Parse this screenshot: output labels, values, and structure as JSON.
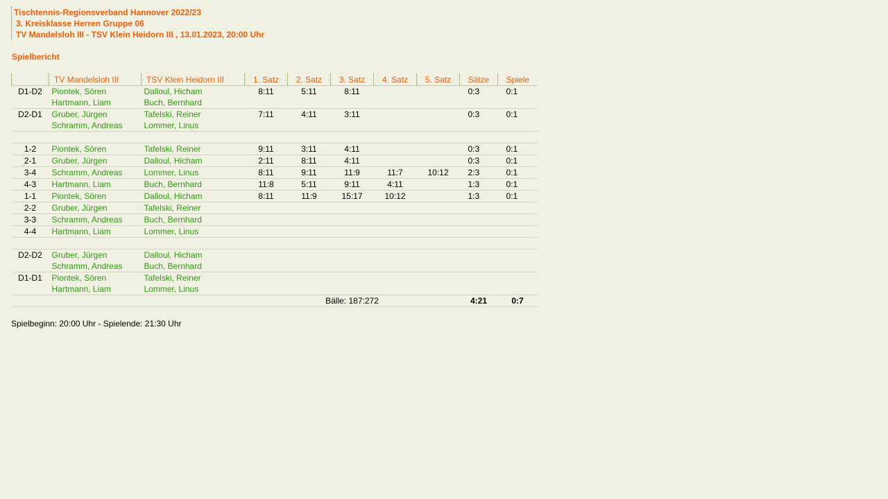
{
  "header": {
    "line1": "Tischtennis-Regionsverband Hannover 2022/23",
    "line2": "3. Kreisklasse Herren Gruppe 06",
    "line3": "TV Mandelsloh III - TSV Klein Heidorn III , 13.01.2023, 20:00 Uhr"
  },
  "section_title": "Spielbericht",
  "columns": {
    "pair": "",
    "home": "TV Mandelsloh III",
    "away": "TSV Klein Heidorn III",
    "s1": "1. Satz",
    "s2": "2. Satz",
    "s3": "3. Satz",
    "s4": "4. Satz",
    "s5": "5. Satz",
    "saetze": "Sätze",
    "spiele": "Spiele"
  },
  "doubles1": [
    {
      "pair": "D1-D2",
      "home": [
        "Piontek, Sören",
        "Hartmann, Liam"
      ],
      "away": [
        "Dalloul, Hicham",
        "Buch, Bernhard"
      ],
      "sets": [
        "8:11",
        "5:11",
        "8:11",
        "",
        ""
      ],
      "saetze": "0:3",
      "spiele": "0:1"
    },
    {
      "pair": "D2-D1",
      "home": [
        "Gruber, Jürgen",
        "Schramm, Andreas"
      ],
      "away": [
        "Tafelski, Reiner",
        "Lommer, Linus"
      ],
      "sets": [
        "7:11",
        "4:11",
        "3:11",
        "",
        ""
      ],
      "saetze": "0:3",
      "spiele": "0:1"
    }
  ],
  "singles": [
    {
      "pair": "1-2",
      "home": "Piontek, Sören",
      "away": "Tafelski, Reiner",
      "sets": [
        "9:11",
        "3:11",
        "4:11",
        "",
        ""
      ],
      "saetze": "0:3",
      "spiele": "0:1"
    },
    {
      "pair": "2-1",
      "home": "Gruber, Jürgen",
      "away": "Dalloul, Hicham",
      "sets": [
        "2:11",
        "8:11",
        "4:11",
        "",
        ""
      ],
      "saetze": "0:3",
      "spiele": "0:1"
    },
    {
      "pair": "3-4",
      "home": "Schramm, Andreas",
      "away": "Lommer, Linus",
      "sets": [
        "8:11",
        "9:11",
        "11:9",
        "11:7",
        "10:12"
      ],
      "saetze": "2:3",
      "spiele": "0:1"
    },
    {
      "pair": "4-3",
      "home": "Hartmann, Liam",
      "away": "Buch, Bernhard",
      "sets": [
        "11:8",
        "5:11",
        "9:11",
        "4:11",
        ""
      ],
      "saetze": "1:3",
      "spiele": "0:1"
    },
    {
      "pair": "1-1",
      "home": "Piontek, Sören",
      "away": "Dalloul, Hicham",
      "sets": [
        "8:11",
        "11:9",
        "15:17",
        "10:12",
        ""
      ],
      "saetze": "1:3",
      "spiele": "0:1"
    },
    {
      "pair": "2-2",
      "home": "Gruber, Jürgen",
      "away": "Tafelski, Reiner",
      "sets": [
        "",
        "",
        "",
        "",
        ""
      ],
      "saetze": "",
      "spiele": ""
    },
    {
      "pair": "3-3",
      "home": "Schramm, Andreas",
      "away": "Buch, Bernhard",
      "sets": [
        "",
        "",
        "",
        "",
        ""
      ],
      "saetze": "",
      "spiele": ""
    },
    {
      "pair": "4-4",
      "home": "Hartmann, Liam",
      "away": "Lommer, Linus",
      "sets": [
        "",
        "",
        "",
        "",
        ""
      ],
      "saetze": "",
      "spiele": ""
    }
  ],
  "doubles2": [
    {
      "pair": "D2-D2",
      "home": [
        "Gruber, Jürgen",
        "Schramm, Andreas"
      ],
      "away": [
        "Dalloul, Hicham",
        "Buch, Bernhard"
      ],
      "sets": [
        "",
        "",
        "",
        "",
        ""
      ],
      "saetze": "",
      "spiele": ""
    },
    {
      "pair": "D1-D1",
      "home": [
        "Piontek, Sören",
        "Hartmann, Liam"
      ],
      "away": [
        "Tafelski, Reiner",
        "Lommer, Linus"
      ],
      "sets": [
        "",
        "",
        "",
        "",
        ""
      ],
      "saetze": "",
      "spiele": ""
    }
  ],
  "totals": {
    "baelle": "Bälle: 187:272",
    "saetze": "4:21",
    "spiele": "0:7"
  },
  "footer": "Spielbeginn: 20:00 Uhr - Spielende: 21:30 Uhr",
  "colors": {
    "background": "#f0f0e3",
    "heading": "#e8600a",
    "player": "#2e9a0e"
  }
}
